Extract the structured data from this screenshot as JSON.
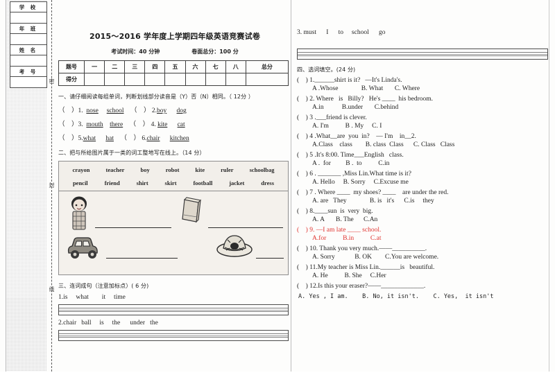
{
  "info_box": {
    "fields": [
      "学  校",
      "年  班",
      "姓  名",
      "考  号"
    ]
  },
  "seal_line": {
    "chars": [
      "密",
      "封",
      "线"
    ]
  },
  "header": {
    "title": "2015～2016 学年度上学期四年级英语竞赛试卷",
    "duration": "考试时间：40 分钟",
    "total": "卷面总分：100 分"
  },
  "score_table": {
    "row_labels": [
      "题号",
      "得分"
    ],
    "columns": [
      "一",
      "二",
      "三",
      "四",
      "五",
      "六",
      "七",
      "八",
      "总分"
    ]
  },
  "section1": {
    "heading": "一、请仔细阅读每组单词，判断划线部分读音是（Y）否（N）相同。（ 12分 ）",
    "items": [
      {
        "mark": "（    ）",
        "num": "1. ",
        "w1": "nose",
        "w2": "school"
      },
      {
        "mark": "（    ）",
        "num": "2.",
        "w1": "boy",
        "w2": "dog"
      },
      {
        "mark": "（    ）",
        "num": "3. ",
        "w1": "mouth",
        "w2": "there"
      },
      {
        "mark": "（    ）",
        "num": "4. ",
        "w1": "kite",
        "w2": "cat"
      },
      {
        "mark": "（    ）",
        "num": "5.",
        "w1": "what",
        "w2": "hat"
      },
      {
        "mark": "（    ）",
        "num": "6.",
        "w1": "chair",
        "w2": "kitchen"
      }
    ]
  },
  "section2": {
    "heading": "二、把与所给图片属于一类的词工整地写在线上。（14 分）",
    "wordbank_row1": [
      "crayon",
      "teacher",
      "boy",
      "robot",
      "kite",
      "ruler",
      "schoolbag"
    ],
    "wordbank_row2": [
      "pencil",
      "friend",
      "shirt",
      "skirt",
      "football",
      "jacket",
      "dress"
    ],
    "pictures": [
      "girl-picture",
      "book-picture",
      "car-picture",
      "hat-picture"
    ]
  },
  "section3": {
    "heading": "三、连词成句（注意加标点）(   6    分)",
    "items": [
      "1.is     what        it     time",
      "2.chair   ball     is     the      under   the",
      "3. must      I      to     school      go"
    ]
  },
  "section4": {
    "heading": "四、选词填空。(24 分)",
    "questions": [
      {
        "mark": "(    )",
        "stem": "1.______shirt is it?   —It's Linda's.",
        "options": "A .Whose              B. What       C. Where",
        "color": "#1e1e1e"
      },
      {
        "mark": "(    )",
        "stem": "2. Where   is   Billy?   He's ____  his bedroom.",
        "options": "A.in           B.under       C.behind",
        "color": "#1e1e1e"
      },
      {
        "mark": "(    )",
        "stem": "3 .___friend is clever.",
        "options": "A. I'm          B . My     C. I",
        "color": "#1e1e1e"
      },
      {
        "mark": "(    )",
        "stem": "4 .What__are  you  in?    — I'm    in__2.",
        "options": "A.Class    class        B. class  Class      C. Class   Class",
        "color": "#1e1e1e"
      },
      {
        "mark": "(    )",
        "stem": "5 .It's 8:00. Time___English   class.",
        "options": "A .  for         B .  to          C.in",
        "color": "#1e1e1e"
      },
      {
        "mark": "(    )",
        "stem": "6 . _______ ,Miss Lin.What time is it?",
        "options": "A. Hello     B. Sorry     C.Excuse me",
        "color": "#1e1e1e"
      },
      {
        "mark": "(    )",
        "stem": "7 . Where ____  my shoes? ____    are under the red.",
        "options": "A. are   They              B. is   it's      C.is     they",
        "color": "#1e1e1e"
      },
      {
        "mark": "(    )",
        "stem": "8.____sun  is  very  big.",
        "options": "A. A       B. The      C.An",
        "color": "#1e1e1e"
      },
      {
        "mark": "(    )",
        "stem": "9. —I am late ____ school.",
        "options": "A.for          B.in          C.at",
        "color": "#e0332f"
      },
      {
        "mark": "(    )",
        "stem": "10. Thank you very much.——__________.",
        "options": "A. Sorry            B. OK        C.You are welcome.",
        "color": "#1e1e1e"
      },
      {
        "mark": "(    )",
        "stem": "11.My teacher is Miss Lin.______is   beautiful.",
        "options": "A. He          B. She     C.Her",
        "color": "#1e1e1e"
      },
      {
        "mark": "(    )",
        "stem": "12.Is this your eraser?——_____________.",
        "options": "",
        "color": "#1e1e1e"
      }
    ],
    "last_options": "A. Yes , I am.    B. No, it isn't.    C. Yes,  it isn't"
  }
}
